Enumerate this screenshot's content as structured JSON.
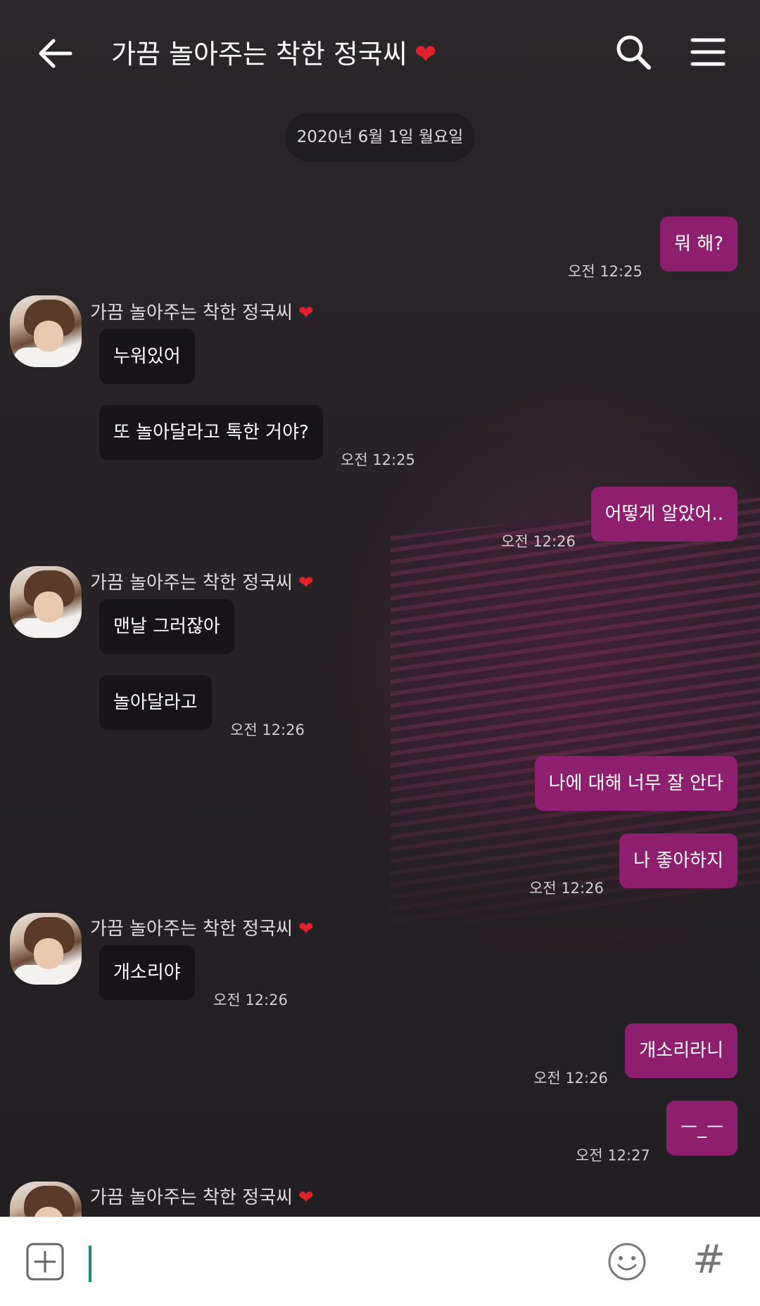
{
  "header": {
    "title": "가끔 놀아주는 착한 정국씨",
    "title_heart": "❤"
  },
  "date_divider": "2020년 6월 1일 월요일",
  "contact": {
    "name": "가끔 놀아주는 착한 정국씨",
    "heart": "❤"
  },
  "messages": [
    {
      "dir": "out",
      "text": "뭐 해?",
      "time": "오전 12:25"
    },
    {
      "dir": "in",
      "text": "누워있어"
    },
    {
      "dir": "in",
      "text": "또 놀아달라고 톡한 거야?",
      "time": "오전 12:25"
    },
    {
      "dir": "out",
      "text": "어떻게 알았어..",
      "time": "오전 12:26"
    },
    {
      "dir": "in",
      "text": "맨날 그러잖아"
    },
    {
      "dir": "in",
      "text": "놀아달라고",
      "time": "오전 12:26"
    },
    {
      "dir": "out",
      "text": "나에 대해 너무 잘 안다"
    },
    {
      "dir": "out",
      "text": "나 좋아하지",
      "time": "오전 12:26"
    },
    {
      "dir": "in",
      "text": "개소리야",
      "time": "오전 12:26"
    },
    {
      "dir": "out",
      "text": "개소리라니",
      "time": "오전 12:26"
    },
    {
      "dir": "out",
      "text": "ㅡ_ㅡ",
      "time": "오전 12:27"
    }
  ],
  "input": {
    "hash": "#"
  },
  "colors": {
    "outgoing_bubble": "#8e1f6e",
    "incoming_bubble": "#161416",
    "heart": "#e0212e"
  },
  "icons": [
    "back-arrow-icon",
    "search-icon",
    "menu-icon",
    "plus-icon",
    "emoji-icon",
    "hashtag-icon"
  ]
}
